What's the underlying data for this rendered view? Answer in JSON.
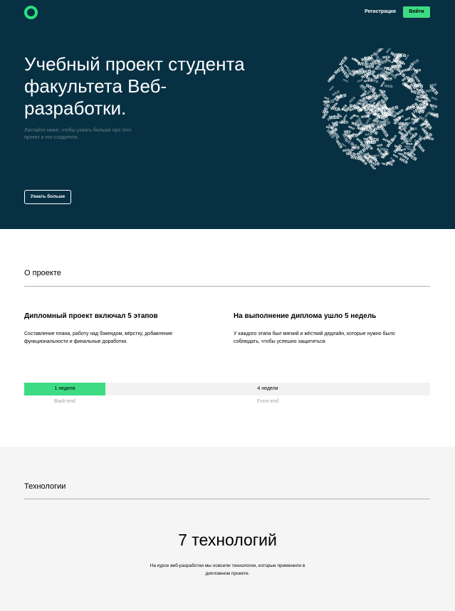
{
  "header": {
    "register_label": "Регистрация",
    "login_label": "Войти",
    "accent_color": "#3ddc84",
    "background_color": "#073042"
  },
  "hero": {
    "title": "Учебный проект студента факультета Веб-разработки.",
    "subtitle": "Листайте ниже, чтобы узнать больше про этот проект и его создателя.",
    "button_label": "Узнать больше",
    "globe_word": "WEB"
  },
  "about": {
    "section_title": "О проекте",
    "columns": [
      {
        "title": "Дипломный проект включал 5 этапов",
        "text": "Составление плана, работу над бэкендом, вёрстку, добавление функциональности и финальные доработки."
      },
      {
        "title": "На выполнение диплома ушло 5 недель",
        "text": "У каждого этапа был мягкий и жёсткий дедлайн, которые нужно было соблюдать, чтобы успешно защититься."
      }
    ],
    "timeline": {
      "backend": {
        "duration": "1 неделя",
        "label": "Back-end",
        "weeks": 1
      },
      "frontend": {
        "duration": "4 недели",
        "label": "Front-end",
        "weeks": 4
      }
    }
  },
  "tech": {
    "section_title": "Технологии",
    "count_title": "7 технологий",
    "text": "На курсе веб-разработки мы освоили технологии, которые применили в дипломном проекте."
  }
}
